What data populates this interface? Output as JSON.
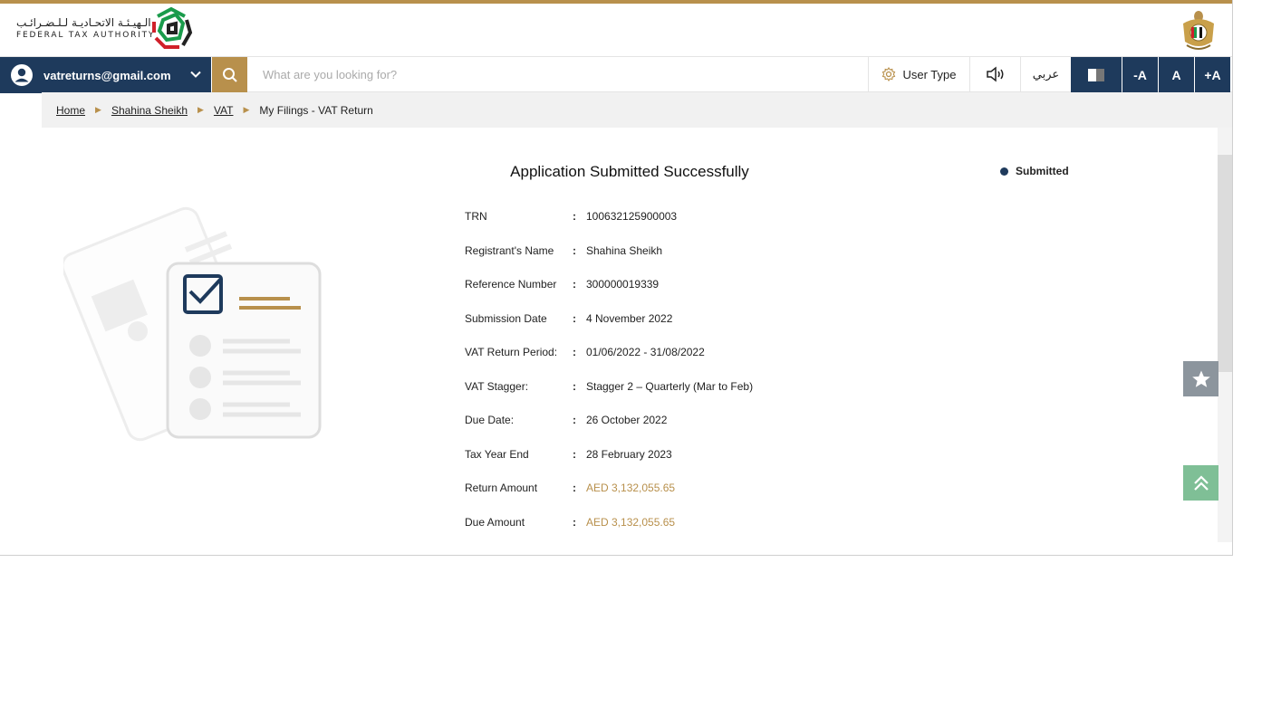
{
  "header": {
    "logo_arabic": "الـهيـئـة الاتحـاديـة لـلـضـرائـب",
    "logo_english": "FEDERAL TAX AUTHORITY"
  },
  "navbar": {
    "user_email": "vatreturns@gmail.com",
    "search_placeholder": "What are you looking for?",
    "user_type_label": "User Type",
    "arabic_label": "عربي",
    "font_decrease_label": "-A",
    "font_normal_label": "A",
    "font_increase_label": "+A"
  },
  "breadcrumb": {
    "items": [
      "Home",
      "Shahina Sheikh",
      "VAT"
    ],
    "current": "My Filings - VAT Return"
  },
  "main": {
    "title": "Application Submitted Successfully",
    "status": "Submitted",
    "details": [
      {
        "label": "TRN",
        "value": "100632125900003"
      },
      {
        "label": "Registrant's Name",
        "value": "Shahina Sheikh"
      },
      {
        "label": "Reference Number",
        "value": "300000019339"
      },
      {
        "label": "Submission Date",
        "value": "4 November 2022"
      },
      {
        "label": "VAT Return Period:",
        "value": "01/06/2022 - 31/08/2022"
      },
      {
        "label": "VAT Stagger:",
        "value": "Stagger 2 – Quarterly (Mar to Feb)"
      },
      {
        "label": "Due Date:",
        "value": "26 October 2022"
      },
      {
        "label": "Tax Year End",
        "value": "28 February 2023"
      },
      {
        "label": "Return Amount",
        "value": "AED 3,132,055.65"
      },
      {
        "label": "Due Amount",
        "value": "AED 3,132,055.65"
      }
    ]
  },
  "colors": {
    "accent_gold": "#b8904c",
    "navy": "#1e3a5c",
    "status_dot": "#1e3a5c"
  },
  "icons": [
    "user-avatar-icon",
    "chevron-down-icon",
    "search-icon",
    "gear-icon",
    "speaker-icon",
    "contrast-icon",
    "star-icon",
    "double-chevron-up-icon"
  ]
}
